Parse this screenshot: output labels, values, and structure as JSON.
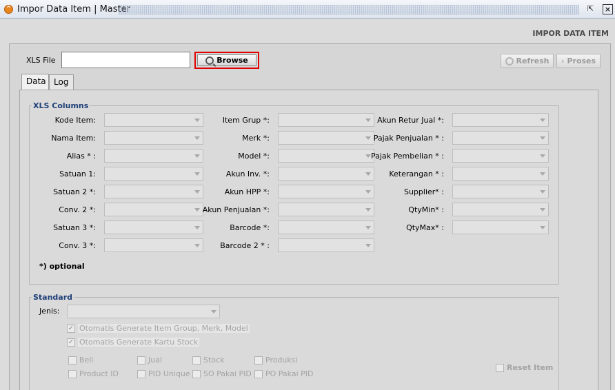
{
  "window": {
    "title": "Impor Data Item | Master"
  },
  "header_label": "IMPOR DATA ITEM",
  "file": {
    "label": "XLS File",
    "value": "",
    "browse_label": "Browse"
  },
  "actions": {
    "refresh_label": "Refresh",
    "proses_label": "Proses"
  },
  "tabs": [
    {
      "label": "Data"
    },
    {
      "label": "Log"
    }
  ],
  "xls_columns": {
    "title": "XLS Columns",
    "col1": [
      "Kode Item:",
      "Nama Item:",
      "Alias * :",
      "Satuan 1:",
      "Satuan 2 *:",
      "Conv. 2 *:",
      "Satuan 3 *:",
      "Conv. 3 *:"
    ],
    "col2": [
      "Item Grup *:",
      "Merk *:",
      "Model *:",
      "Akun Inv. *:",
      "Akun HPP *:",
      "Akun Penjualan *:",
      "Barcode *:",
      "Barcode 2 * :"
    ],
    "col3": [
      "Akun Retur Jual *:",
      "Pajak Penjualan * :",
      "Pajak Pembelian * :",
      "Keterangan * :",
      "Supplier* :",
      "QtyMin* :",
      "QtyMax* :"
    ],
    "optional_note": "*) optional"
  },
  "standard": {
    "title": "Standard",
    "jenis_label": "Jenis:",
    "checks_top": [
      {
        "label": "Otomatis Generate Item Group, Merk, Model",
        "checked": true
      },
      {
        "label": "Otomatis Generate Kartu Stock",
        "checked": true
      }
    ],
    "checks_row1": [
      "Beli",
      "Jual",
      "Stock",
      "Produksi"
    ],
    "checks_row2": [
      "Product ID",
      "PID Unique",
      "SO Pakai PID",
      "PO Pakai PID"
    ],
    "reset_label": "Reset Item"
  },
  "colors": {
    "group_title": "#1f3f78",
    "highlight_border": "#e00000"
  }
}
